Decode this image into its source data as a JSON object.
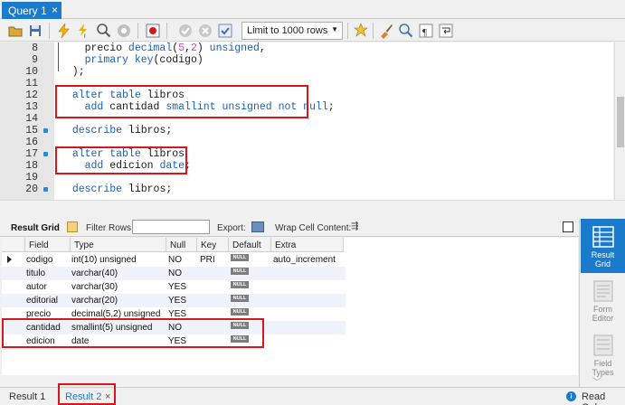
{
  "query_tab": {
    "label": "Query 1"
  },
  "toolbar": {
    "limit_label": "Limit to 1000 rows"
  },
  "editor": {
    "lines": [
      {
        "num": "8",
        "code": "    precio decimal(5,2) unsigned,"
      },
      {
        "num": "9",
        "code": "    primary key(codigo)"
      },
      {
        "num": "10",
        "code": "  );"
      },
      {
        "num": "11",
        "code": ""
      },
      {
        "num": "12",
        "code": "  alter table libros"
      },
      {
        "num": "13",
        "code": "    add cantidad smallint unsigned not null;"
      },
      {
        "num": "14",
        "code": ""
      },
      {
        "num": "15",
        "code": "  describe libros;"
      },
      {
        "num": "16",
        "code": ""
      },
      {
        "num": "17",
        "code": "  alter table libros"
      },
      {
        "num": "18",
        "code": "    add edicion date;"
      },
      {
        "num": "19",
        "code": ""
      },
      {
        "num": "20",
        "code": "  describe libros;"
      }
    ]
  },
  "results_toolbar": {
    "result_grid": "Result Grid",
    "filter_rows": "Filter Rows:",
    "export": "Export:",
    "wrap": "Wrap Cell Content:"
  },
  "grid": {
    "columns": [
      "Field",
      "Type",
      "Null",
      "Key",
      "Default",
      "Extra"
    ],
    "rows": [
      [
        "codigo",
        "int(10) unsigned",
        "NO",
        "PRI",
        "NULL",
        "auto_increment"
      ],
      [
        "titulo",
        "varchar(40)",
        "NO",
        "",
        "NULL",
        ""
      ],
      [
        "autor",
        "varchar(30)",
        "YES",
        "",
        "NULL",
        ""
      ],
      [
        "editorial",
        "varchar(20)",
        "YES",
        "",
        "NULL",
        ""
      ],
      [
        "precio",
        "decimal(5,2) unsigned",
        "YES",
        "",
        "NULL",
        ""
      ],
      [
        "cantidad",
        "smallint(5) unsigned",
        "NO",
        "",
        "NULL",
        ""
      ],
      [
        "edicion",
        "date",
        "YES",
        "",
        "NULL",
        ""
      ]
    ]
  },
  "side_panel": {
    "result_grid": "Result\nGrid",
    "form_editor": "Form\nEditor",
    "field_types": "Field\nTypes"
  },
  "bottom": {
    "tab1": "Result 1",
    "tab2": "Result 2",
    "status": "Read Only"
  }
}
